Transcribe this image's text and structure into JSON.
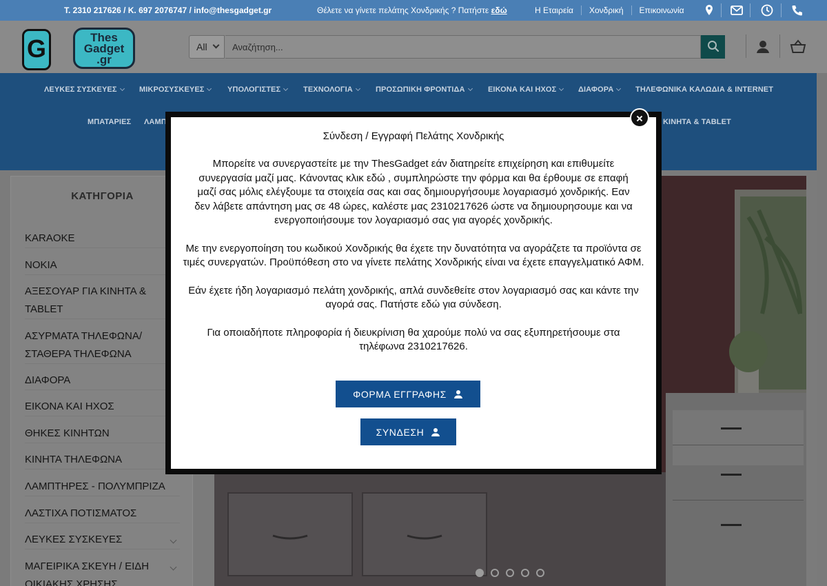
{
  "topbar": {
    "contact": "T. 2310 217626 / K. 697 2076747 / info@thesgadget.gr",
    "wholesale_text": "Θέλετε να γίνετε πελάτης Χονδρικής ? Πατήστε",
    "wholesale_link": "εδώ",
    "links": [
      "Η Εταιρεία",
      "Χονδρική",
      "Επικοινωνία"
    ],
    "icons": [
      "map-marker-icon",
      "envelope-icon",
      "clock-icon",
      "phone-icon"
    ]
  },
  "header": {
    "logo_text": "Thes Gadget .gr",
    "logo_mark": "G",
    "search_category": "All",
    "search_placeholder": "Αναζήτηση...",
    "icons": [
      "search-icon",
      "user-icon",
      "cart-icon"
    ]
  },
  "nav": {
    "row1": [
      "ΛΕΥΚΕΣ ΣΥΣΚΕΥΕΣ",
      "ΜΙΚΡΟΣΥΣΚΕΥΕΣ",
      "ΥΠΟΛΟΓΙΣΤΕΣ",
      "ΤΕΧΝΟΛΟΓΙΑ",
      "ΠΡΟΣΩΠΙΚΗ ΦΡΟΝΤΙΔΑ",
      "ΕΙΚΟΝΑ ΚΑΙ ΗΧΟΣ",
      "ΔΙΑΦΟΡΑ",
      "ΤΗΛΕΦΩΝΙΚΑ ΚΑΛΩΔΙΑ & INTERNET"
    ],
    "row2_left": [
      "ΜΠΑΤΑΡΙΕΣ",
      "ΛΑΜΠ"
    ],
    "row2_right": "ΚΙΝΗΤΑ & TABLET"
  },
  "sidebar": {
    "title": "ΚΑΤΗΓΟΡΙΑ",
    "items": [
      "KARAOKE",
      "NOKIA",
      "ΑΞΕΣΟΥΑΡ ΓΙΑ ΚΙΝΗΤΑ & TABLET",
      "ΑΣΥΡΜΑΤΑ ΤΗΛΕΦΩΝΑ/ ΣΤΑΘΕΡΑ ΤΗΛΕΦΩΝΑ",
      "ΔΙΑΦΟΡΑ",
      "ΕΙΚΟΝΑ ΚΑΙ ΗΧΟΣ",
      "ΘΗΚΕΣ ΚΙΝΗΤΩΝ",
      "ΚΙΝΗΤΑ ΤΗΛΕΦΩΝΑ",
      "ΛΑΜΠΤΗΡΕΣ - ΠΟΛΥΜΠΡΙΖΑ",
      "ΛΑΣΤΙΧΑ ΠΟΤΙΣΜΑΤΟΣ",
      "ΛΕΥΚΕΣ ΣΥΣΚΕΥΕΣ",
      "ΜΑΓΕΙΡΙΚΑ ΣΚΕΥΗ / ΕΙΔΗ ΟΙΚΙΑΚΗΣ ΧΡΗΣΗΣ"
    ]
  },
  "slider": {
    "dots": 5,
    "active": 0
  },
  "modal": {
    "title": "Σύνδεση / Εγγραφή Πελάτης Χονδρικής",
    "p1": "Μπορείτε να συνεργαστείτε με την ThesGadget εάν διατηρείτε επιχείρηση και επιθυμείτε συνεργασία μαζί μας. Κάνοντας κλικ εδώ , συμπληρώστε την φόρμα και θα έρθουμε σε επαφή μαζί σας μόλις ελέγξουμε τα στοιχεία σας και σας δημιουργήσουμε λογαριασμό χονδρικής. Εαν δεν λάβετε απάντηση μας σε 48 ώρες, καλέστε μας 2310217626 ώστε να δημιουρησουμε και να ενεργοποιήσουμε τον λογαριασμό σας για αγορές χονδρικής.",
    "p2": "Με την ενεργοποίηση του κωδικού Χονδρικής θα έχετε την δυνατότητα να αγοράζετε τα προϊόντα σε τιμές συνεργατών. Προϋπόθεση στο να γίνετε πελάτης Χονδρικής είναι να έχετε επαγγελματικό ΑΦΜ.",
    "p3": "Εάν έχετε ήδη λογαριασμό πελάτη χονδρικής, απλά συνδεθείτε στον λογαριασμό σας και κάντε την αγορά σας. Πατήστε εδώ για σύνδεση.",
    "p4": "Για οποιαδήποτε πληροφορία ή διευκρίνιση θα χαρούμε πολύ να σας εξυπηρετήσουμε στα τηλέφωνα 2310217626.",
    "btn_register": "ΦΟΡΜΑ ΕΓΓΡΑΦΗΣ",
    "btn_login": "ΣΥΝΔΕΣΗ"
  }
}
